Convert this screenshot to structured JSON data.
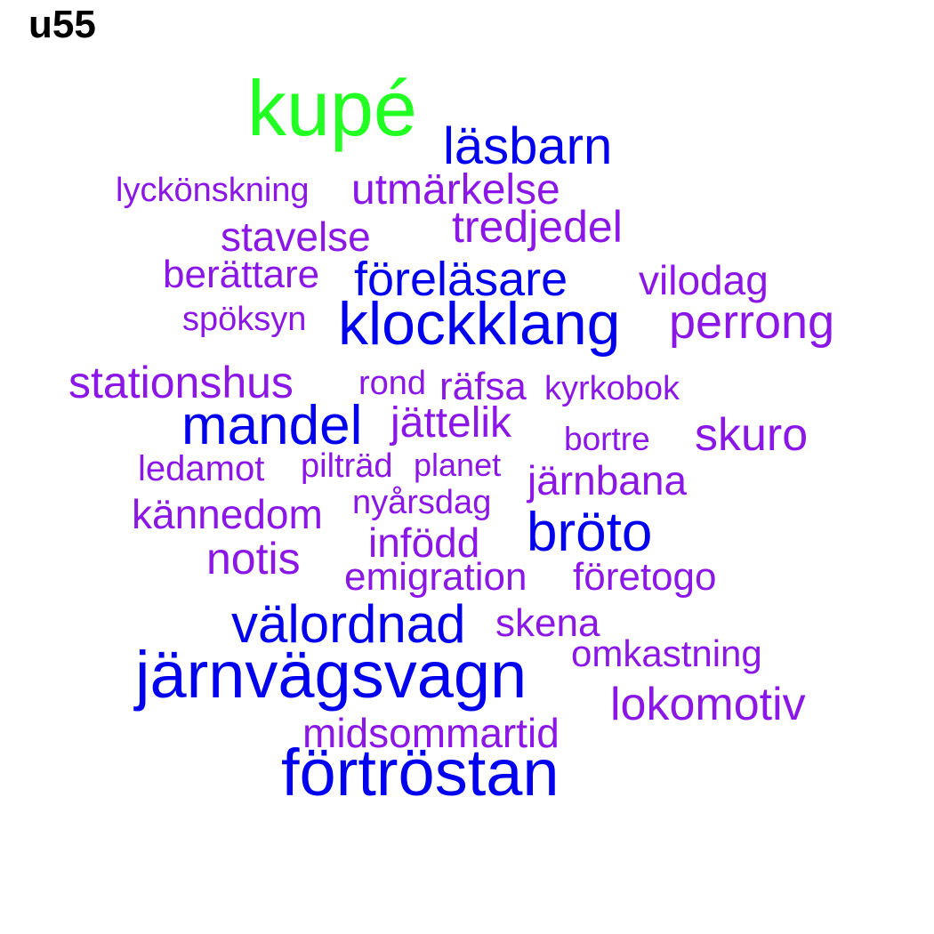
{
  "title": "u55",
  "colors": {
    "green": "#22ff22",
    "blue": "#0000ee",
    "purple": "#8a17e6"
  },
  "words": [
    {
      "text": "kupé",
      "color": "green"
    },
    {
      "text": "läsbarn",
      "color": "blue"
    },
    {
      "text": "lyckönskning",
      "color": "purple"
    },
    {
      "text": "utmärkelse",
      "color": "purple"
    },
    {
      "text": "tredjedel",
      "color": "purple"
    },
    {
      "text": "stavelse",
      "color": "purple"
    },
    {
      "text": "berättare",
      "color": "purple"
    },
    {
      "text": "föreläsare",
      "color": "blue"
    },
    {
      "text": "vilodag",
      "color": "purple"
    },
    {
      "text": "spöksyn",
      "color": "purple"
    },
    {
      "text": "klockklang",
      "color": "blue"
    },
    {
      "text": "perrong",
      "color": "purple"
    },
    {
      "text": "stationshus",
      "color": "purple"
    },
    {
      "text": "rond",
      "color": "purple"
    },
    {
      "text": "räfsa",
      "color": "purple"
    },
    {
      "text": "kyrkobok",
      "color": "purple"
    },
    {
      "text": "mandel",
      "color": "blue"
    },
    {
      "text": "jättelik",
      "color": "purple"
    },
    {
      "text": "bortre",
      "color": "purple"
    },
    {
      "text": "skuro",
      "color": "purple"
    },
    {
      "text": "ledamot",
      "color": "purple"
    },
    {
      "text": "pilträd",
      "color": "purple"
    },
    {
      "text": "planet",
      "color": "purple"
    },
    {
      "text": "järnbana",
      "color": "purple"
    },
    {
      "text": "kännedom",
      "color": "purple"
    },
    {
      "text": "nyårsdag",
      "color": "purple"
    },
    {
      "text": "bröto",
      "color": "blue"
    },
    {
      "text": "infödd",
      "color": "purple"
    },
    {
      "text": "notis",
      "color": "purple"
    },
    {
      "text": "emigration",
      "color": "purple"
    },
    {
      "text": "företogo",
      "color": "purple"
    },
    {
      "text": "välordnad",
      "color": "blue"
    },
    {
      "text": "skena",
      "color": "purple"
    },
    {
      "text": "omkastning",
      "color": "purple"
    },
    {
      "text": "järnvägsvagn",
      "color": "blue"
    },
    {
      "text": "lokomotiv",
      "color": "purple"
    },
    {
      "text": "midsommartid",
      "color": "purple"
    },
    {
      "text": "förtröstan",
      "color": "blue"
    }
  ]
}
